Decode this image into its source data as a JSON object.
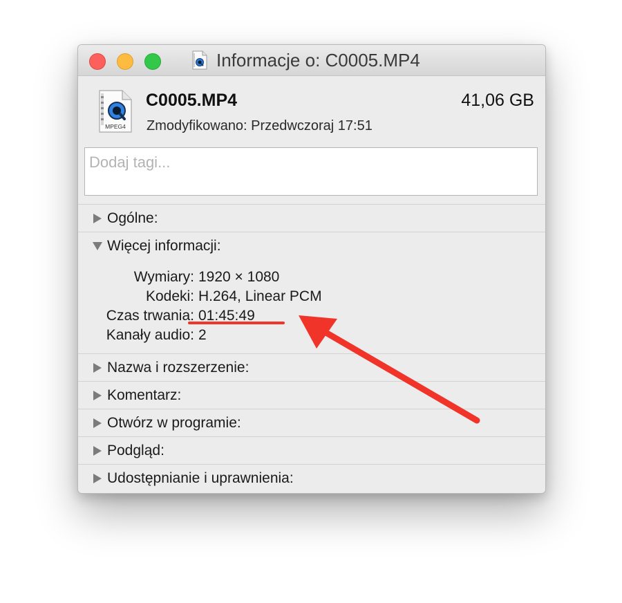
{
  "window": {
    "title": "Informacje o: C0005.MP4"
  },
  "file": {
    "name": "C0005.MP4",
    "size": "41,06 GB",
    "modified": "Zmodyfikowano: Przedwczoraj 17:51",
    "icon_label": "MPEG4",
    "icon": "quicktime-mpeg4-file-icon"
  },
  "tags": {
    "placeholder": "Dodaj tagi..."
  },
  "sections": {
    "general": "Ogólne:",
    "more_info": "Więcej informacji:",
    "name_ext": "Nazwa i rozszerzenie:",
    "comment": "Komentarz:",
    "open_with": "Otwórz w programie:",
    "preview": "Podgląd:",
    "sharing": "Udostępnianie i uprawnienia:"
  },
  "more_info": [
    {
      "key": "Wymiary:",
      "value": "1920 × 1080"
    },
    {
      "key": "Kodeki:",
      "value": "H.264, Linear PCM"
    },
    {
      "key": "Czas trwania:",
      "value": "01:45:49"
    },
    {
      "key": "Kanały audio:",
      "value": "2"
    }
  ],
  "colors": {
    "annotation": "#f0342a",
    "close": "#fc605c",
    "minimize": "#fdbc40",
    "zoom": "#34c84a"
  }
}
